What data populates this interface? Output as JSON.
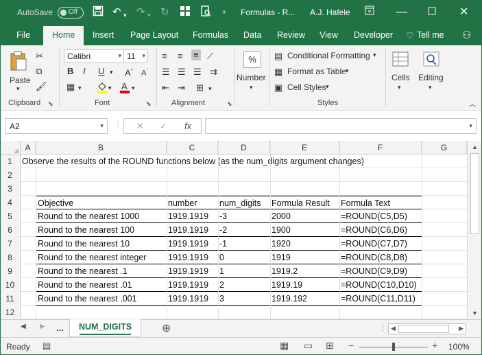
{
  "titlebar": {
    "autosave_label": "AutoSave",
    "autosave_state": "Off",
    "doc_title": "Formulas - R...",
    "user_name": "A.J. Hafele",
    "icons": [
      "save-icon",
      "undo-icon",
      "redo-icon",
      "refresh-icon",
      "form-icon",
      "print-preview-icon",
      "customize-qat-icon",
      "ribbon-display-icon",
      "minimize-icon",
      "restore-icon",
      "close-icon"
    ]
  },
  "tabs": {
    "file": "File",
    "home": "Home",
    "insert": "Insert",
    "page_layout": "Page Layout",
    "formulas": "Formulas",
    "data": "Data",
    "review": "Review",
    "view": "View",
    "developer": "Developer",
    "tell_me": "Tell me"
  },
  "ribbon": {
    "clipboard": {
      "paste": "Paste",
      "label": "Clipboard"
    },
    "font": {
      "name": "Calibri",
      "size": "11",
      "label": "Font",
      "bold": "B",
      "italic": "I",
      "underline": "U"
    },
    "alignment": {
      "label": "Alignment"
    },
    "number": {
      "label": "Number",
      "symbol": "%"
    },
    "styles": {
      "conditional": "Conditional Formatting",
      "format_table": "Format as Table",
      "cell_styles": "Cell Styles",
      "label": "Styles"
    },
    "cells": {
      "label": "Cells"
    },
    "editing": {
      "label": "Editing"
    }
  },
  "formula_bar": {
    "name_box": "A2",
    "fx": "fx",
    "formula": ""
  },
  "grid": {
    "columns": [
      "A",
      "B",
      "C",
      "D",
      "E",
      "F",
      "G"
    ],
    "rows": [
      "1",
      "2",
      "3",
      "4",
      "5",
      "6",
      "7",
      "8",
      "9",
      "10",
      "11",
      "12"
    ],
    "intro_text": "Observe the results of the ROUND functions below (as the num_digits argument changes)",
    "table_headers": [
      "Objective",
      "number",
      "num_digits",
      "Formula Result",
      "Formula Text"
    ],
    "table_rows": [
      [
        "Round to the nearest 1000",
        "1919.1919",
        "-3",
        "2000",
        "=ROUND(C5,D5)"
      ],
      [
        "Round to the nearest 100",
        "1919.1919",
        "-2",
        "1900",
        "=ROUND(C6,D6)"
      ],
      [
        "Round to the nearest 10",
        "1919.1919",
        "-1",
        "1920",
        "=ROUND(C7,D7)"
      ],
      [
        "Round to the nearest integer",
        "1919.1919",
        "0",
        "1919",
        "=ROUND(C8,D8)"
      ],
      [
        "Round to the nearest .1",
        "1919.1919",
        "1",
        "1919.2",
        "=ROUND(C9,D9)"
      ],
      [
        "Round to the nearest .01",
        "1919.1919",
        "2",
        "1919.19",
        "=ROUND(C10,D10)"
      ],
      [
        "Round to the nearest .001",
        "1919.1919",
        "3",
        "1919.192",
        "=ROUND(C11,D11)"
      ]
    ]
  },
  "sheets": {
    "ellipsis": "...",
    "active": "NUM_DIGITS"
  },
  "status": {
    "ready": "Ready",
    "zoom": "100%"
  },
  "colors": {
    "accent": "#217346",
    "ribbon_bg": "#f3f3f3"
  }
}
